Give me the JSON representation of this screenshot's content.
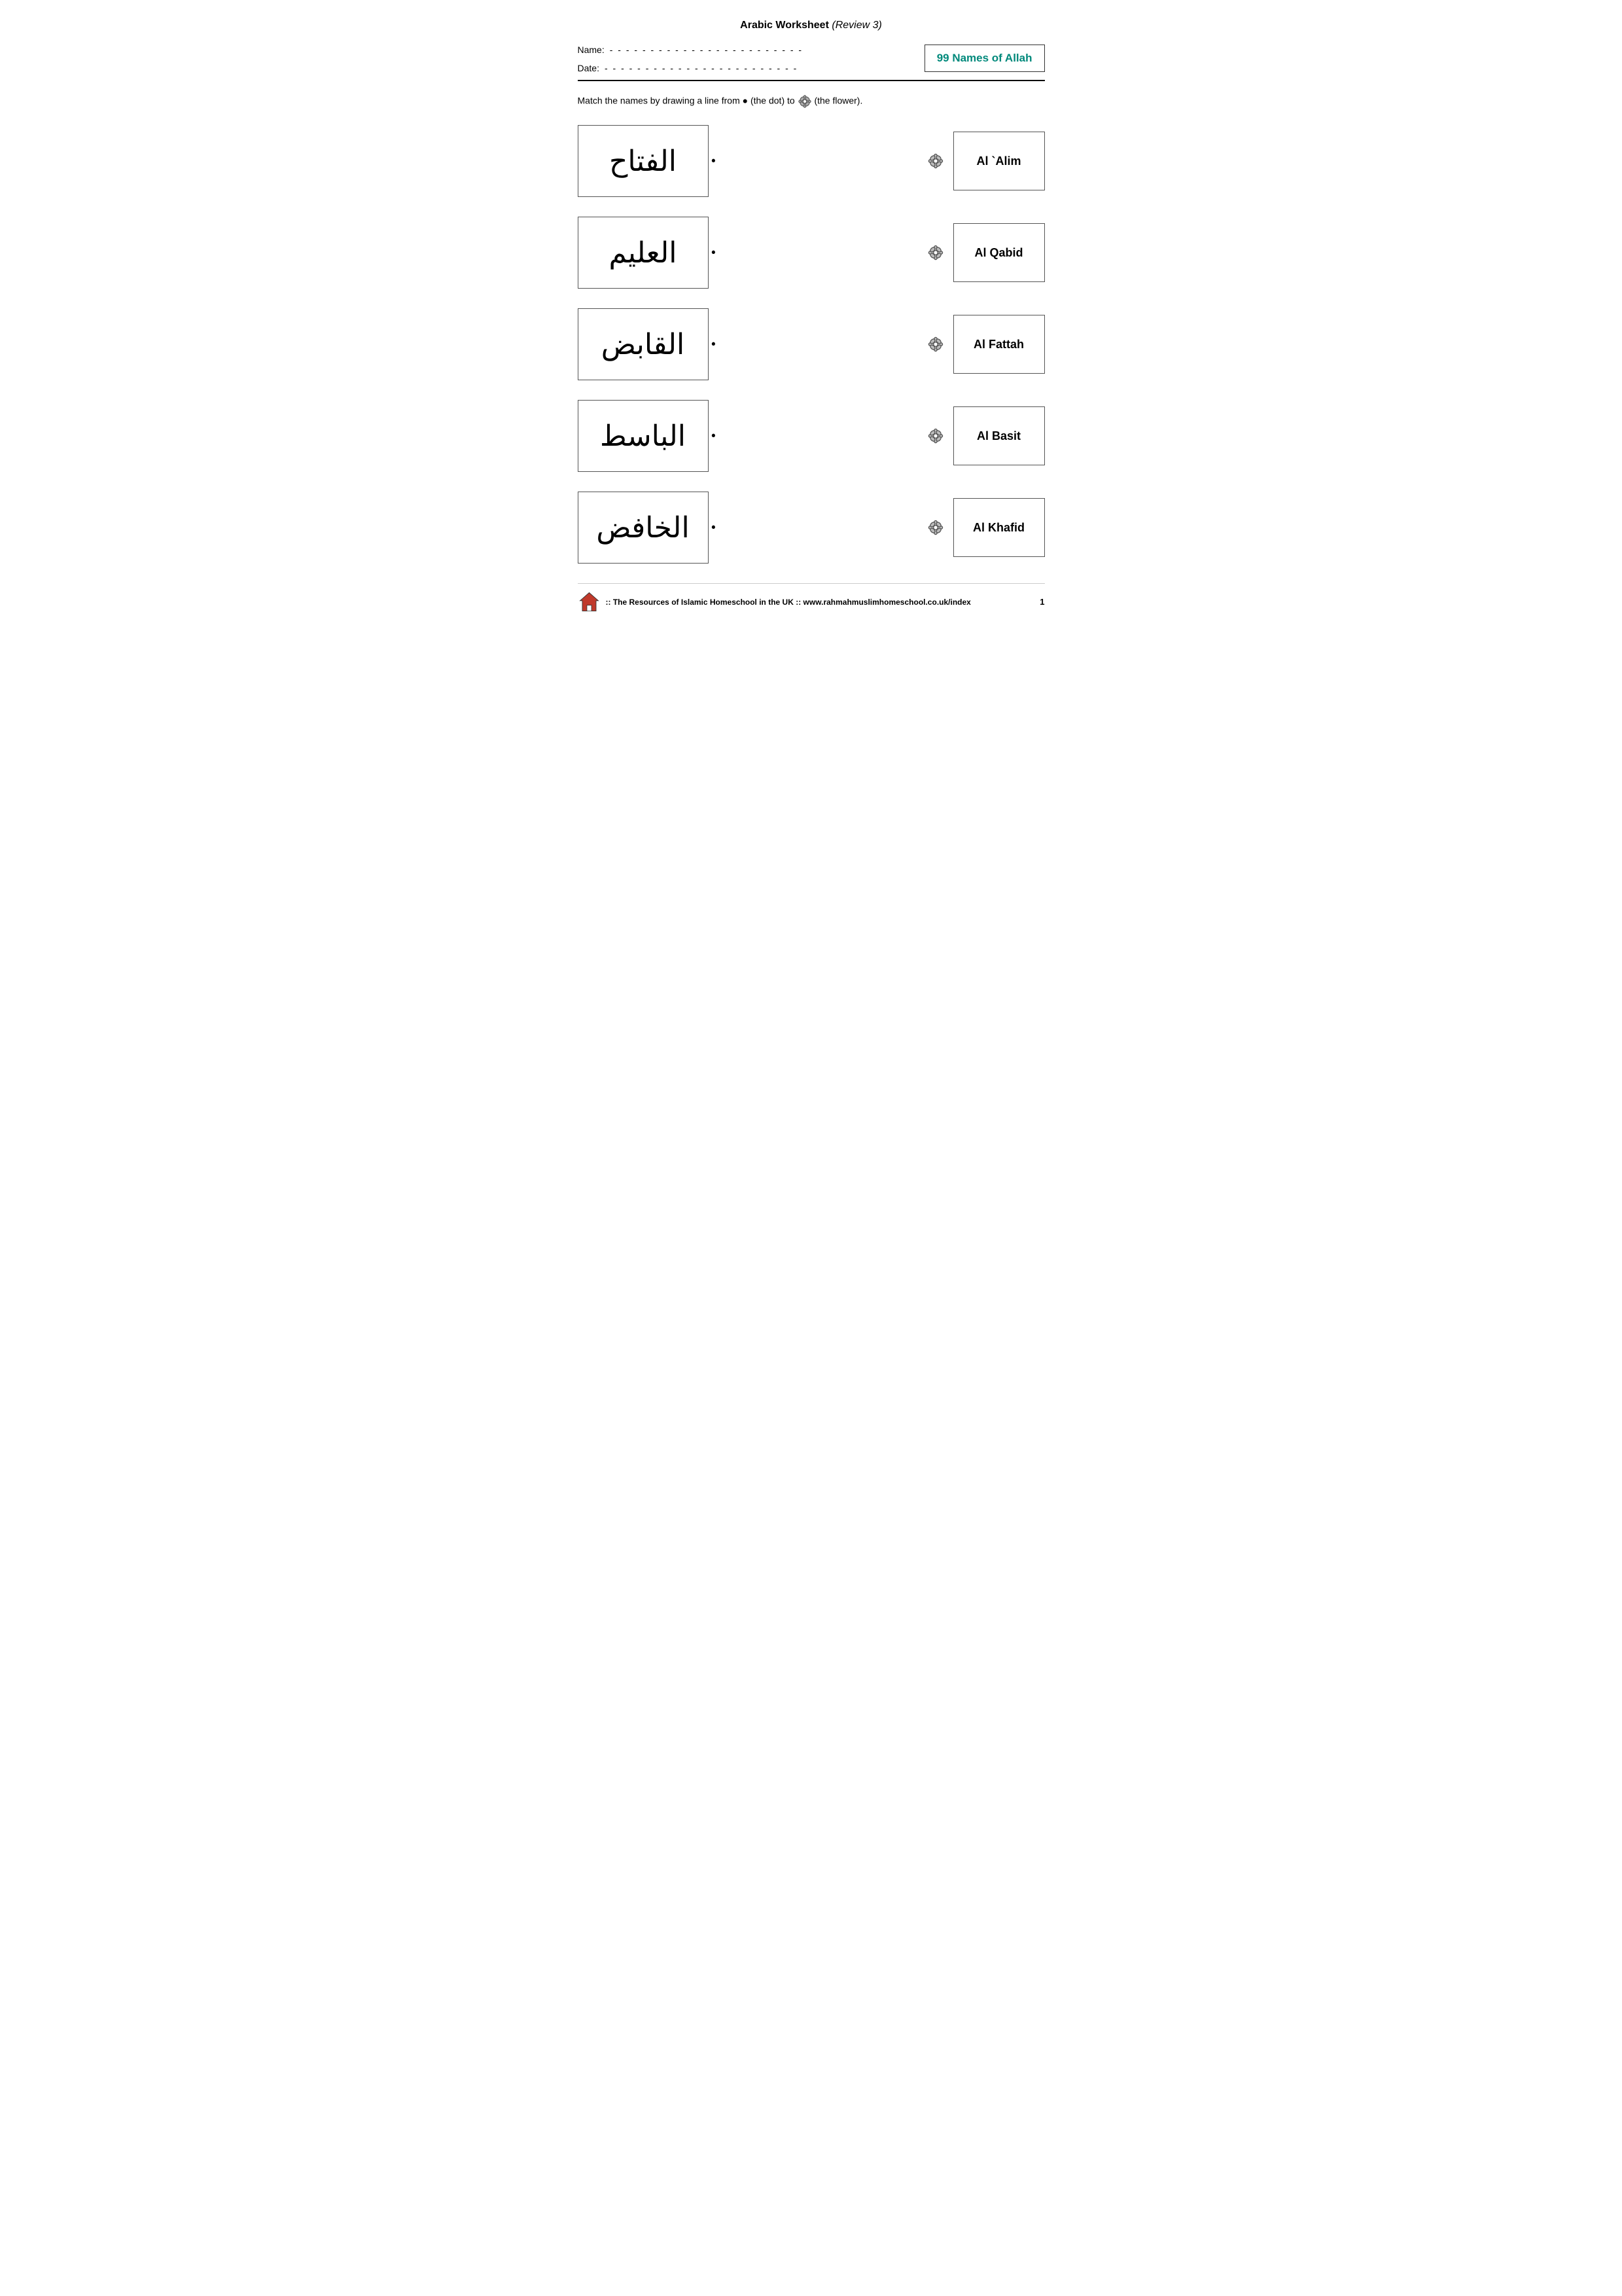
{
  "page": {
    "title_plain": "Arabic Worksheet ",
    "title_italic": "(Review 3)",
    "badge_text": "99 Names of Allah",
    "name_label": "Name:",
    "name_dashes": "- - - - - - - - - - - - - - - - - - - - - - - -",
    "date_label": "Date:",
    "date_dashes": "- - - - - - - - - - - - - - - - - - - - - - - -",
    "instructions": "Match the names by drawing a line from ● (the dot) to 🌸(the flower).",
    "footer_text": ":: The Resources of Islamic Homeschool in the UK ::  www.rahmahmuslimhomeschool.co.uk/index",
    "page_number": "1"
  },
  "matches": [
    {
      "arabic": "الفتاح",
      "english": "Al `Alim"
    },
    {
      "arabic": "العليم",
      "english": "Al Qabid"
    },
    {
      "arabic": "القابض",
      "english": "Al Fattah"
    },
    {
      "arabic": "الباسط",
      "english": "Al Basit"
    },
    {
      "arabic": "الخافض",
      "english": "Al Khafid"
    }
  ]
}
